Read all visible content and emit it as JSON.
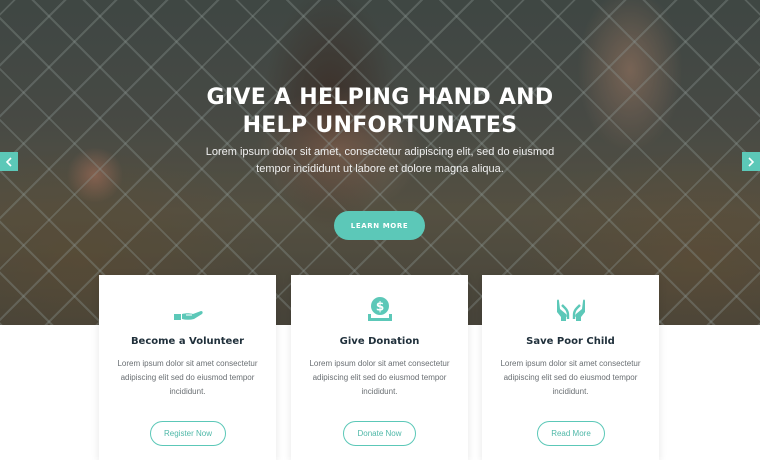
{
  "hero": {
    "title_line1": "GIVE A HELPING HAND AND",
    "title_line2": "HELP UNFORTUNATES",
    "text_line1": "Lorem ipsum dolor sit amet, consectetur adipiscing elit, sed do eiusmod",
    "text_line2": "tempor incididunt ut labore et dolore magna aliqua.",
    "button_label": "LEARN MORE"
  },
  "slider": {
    "prev_icon": "chevron-left-icon",
    "next_icon": "chevron-right-icon"
  },
  "cards": [
    {
      "icon": "helping-hand-icon",
      "title": "Become a Volunteer",
      "text_line1": "Lorem ipsum dolor sit amet consectetur",
      "text_line2": "adipiscing elit sed do eiusmod tempor",
      "text_line3": "incididunt.",
      "button_label": "Register Now"
    },
    {
      "icon": "donation-coin-icon",
      "title": "Give Donation",
      "text_line1": "Lorem ipsum dolor sit amet consectetur",
      "text_line2": "adipiscing elit sed do eiusmod tempor",
      "text_line3": "incididunt.",
      "button_label": "Donate Now"
    },
    {
      "icon": "caring-hands-icon",
      "title": "Save Poor Child",
      "text_line1": "Lorem ipsum dolor sit amet consectetur",
      "text_line2": "adipiscing elit sed do eiusmod tempor",
      "text_line3": "incididunt.",
      "button_label": "Read More"
    }
  ],
  "colors": {
    "accent": "#5cc8b8",
    "heading": "#1f2f3a",
    "body_text": "#6a6f73"
  }
}
